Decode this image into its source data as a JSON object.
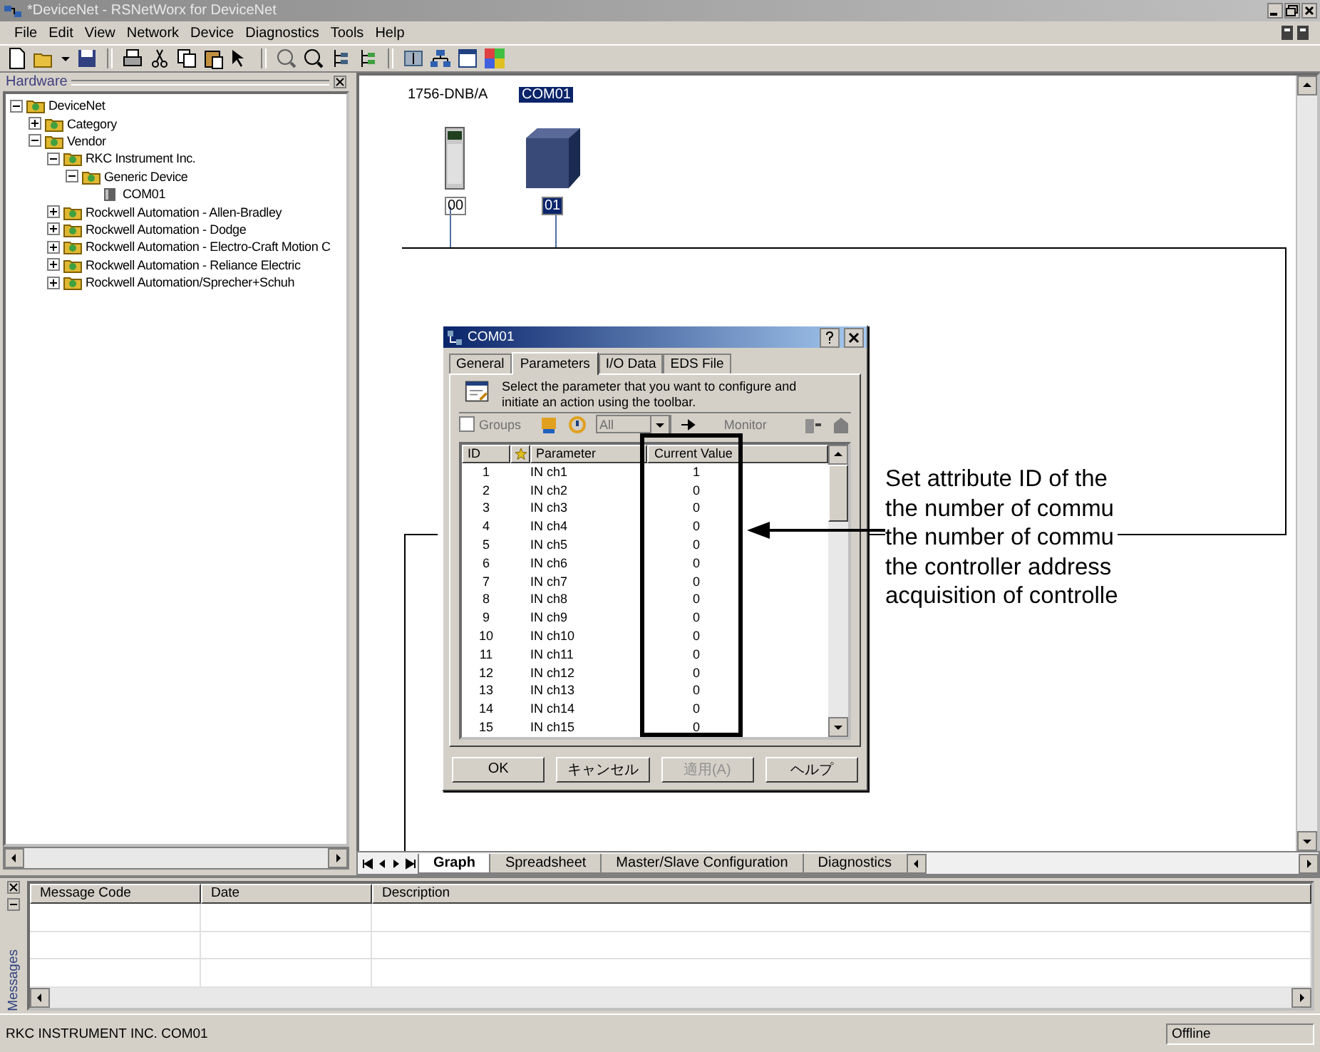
{
  "window": {
    "title": "*DeviceNet - RSNetWorx for DeviceNet"
  },
  "menu": [
    "File",
    "Edit",
    "View",
    "Network",
    "Device",
    "Diagnostics",
    "Tools",
    "Help"
  ],
  "hardware_panel": {
    "title": "Hardware",
    "tree": [
      {
        "label": "DeviceNet",
        "kind": "folder",
        "expanded": true,
        "children": [
          {
            "label": "Category",
            "kind": "folder",
            "expanded": false
          },
          {
            "label": "Vendor",
            "kind": "folder",
            "expanded": true,
            "children": [
              {
                "label": "RKC Instrument Inc.",
                "kind": "folder",
                "expanded": true,
                "children": [
                  {
                    "label": "Generic Device",
                    "kind": "folder",
                    "expanded": true,
                    "children": [
                      {
                        "label": "COM01",
                        "kind": "device"
                      }
                    ]
                  }
                ]
              },
              {
                "label": "Rockwell Automation - Allen-Bradley",
                "kind": "folder",
                "expanded": false
              },
              {
                "label": "Rockwell Automation - Dodge",
                "kind": "folder",
                "expanded": false
              },
              {
                "label": "Rockwell Automation - Electro-Craft Motion C",
                "kind": "folder",
                "expanded": false
              },
              {
                "label": "Rockwell Automation - Reliance Electric",
                "kind": "folder",
                "expanded": false
              },
              {
                "label": "Rockwell Automation/Sprecher+Schuh",
                "kind": "folder",
                "expanded": false
              }
            ]
          }
        ]
      }
    ]
  },
  "network": {
    "nodes": [
      {
        "label": "1756-DNB/A",
        "address": "00",
        "kind": "scanner",
        "selected": false
      },
      {
        "label": "COM01",
        "address": "01",
        "kind": "module",
        "selected": true
      }
    ]
  },
  "view_tabs": [
    {
      "label": "Graph",
      "selected": true
    },
    {
      "label": "Spreadsheet",
      "selected": false
    },
    {
      "label": "Master/Slave Configuration",
      "selected": false
    },
    {
      "label": "Diagnostics",
      "selected": false
    }
  ],
  "dialog": {
    "title": "COM01",
    "tabs": [
      {
        "label": "General",
        "selected": false
      },
      {
        "label": "Parameters",
        "selected": true
      },
      {
        "label": "I/O Data",
        "selected": false
      },
      {
        "label": "EDS File",
        "selected": false
      }
    ],
    "hint": "Select the parameter that you want to configure and initiate an action using the toolbar.",
    "groups_checkbox": {
      "label": "Groups",
      "checked": false,
      "disabled": true
    },
    "filter": {
      "value": "All",
      "disabled": true
    },
    "monitor_button": {
      "label": "Monitor",
      "disabled": true
    },
    "columns": [
      "ID",
      "Parameter",
      "Current Value"
    ],
    "rows": [
      {
        "id": "1",
        "parameter": "IN ch1",
        "value": "1"
      },
      {
        "id": "2",
        "parameter": "IN ch2",
        "value": "0"
      },
      {
        "id": "3",
        "parameter": "IN ch3",
        "value": "0"
      },
      {
        "id": "4",
        "parameter": "IN ch4",
        "value": "0"
      },
      {
        "id": "5",
        "parameter": "IN ch5",
        "value": "0"
      },
      {
        "id": "6",
        "parameter": "IN ch6",
        "value": "0"
      },
      {
        "id": "7",
        "parameter": "IN ch7",
        "value": "0"
      },
      {
        "id": "8",
        "parameter": "IN ch8",
        "value": "0"
      },
      {
        "id": "9",
        "parameter": "IN ch9",
        "value": "0"
      },
      {
        "id": "10",
        "parameter": "IN ch10",
        "value": "0"
      },
      {
        "id": "11",
        "parameter": "IN ch11",
        "value": "0"
      },
      {
        "id": "12",
        "parameter": "IN ch12",
        "value": "0"
      },
      {
        "id": "13",
        "parameter": "IN ch13",
        "value": "0"
      },
      {
        "id": "14",
        "parameter": "IN ch14",
        "value": "0"
      },
      {
        "id": "15",
        "parameter": "IN ch15",
        "value": "0"
      }
    ],
    "buttons": [
      {
        "label": "OK",
        "disabled": false
      },
      {
        "label": "キャンセル",
        "disabled": false
      },
      {
        "label": "適用(A)",
        "disabled": true
      },
      {
        "label": "ヘルプ",
        "disabled": false
      }
    ]
  },
  "annotation": {
    "lines": [
      "Set attribute ID of the",
      "the number of commu",
      "the number of commu",
      "the controller address",
      "acquisition of controlle"
    ]
  },
  "messages": {
    "title": "Messages",
    "columns": [
      "Message Code",
      "Date",
      "Description"
    ]
  },
  "status_bar": {
    "left": "RKC INSTRUMENT INC. COM01",
    "right": "Offline"
  }
}
